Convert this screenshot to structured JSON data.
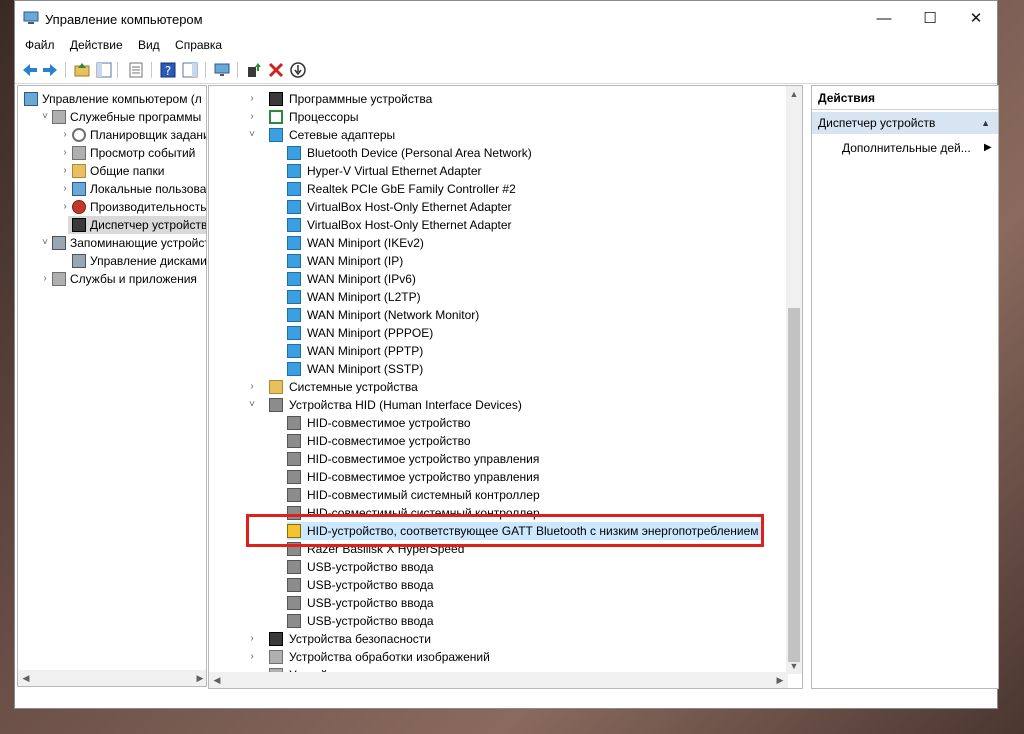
{
  "window": {
    "title": "Управление компьютером"
  },
  "menu": [
    "Файл",
    "Действие",
    "Вид",
    "Справка"
  ],
  "left_tree": {
    "root": "Управление компьютером (л",
    "items": [
      {
        "label": "Служебные программы",
        "level": 1,
        "expander": "down",
        "icon": "tools-icon"
      },
      {
        "label": "Планировщик заданий",
        "level": 2,
        "expander": "right",
        "icon": "clock-icon"
      },
      {
        "label": "Просмотр событий",
        "level": 2,
        "expander": "right",
        "icon": "event-viewer-icon"
      },
      {
        "label": "Общие папки",
        "level": 2,
        "expander": "right",
        "icon": "folder-icon"
      },
      {
        "label": "Локальные пользовате",
        "level": 2,
        "expander": "right",
        "icon": "users-icon"
      },
      {
        "label": "Производительность",
        "level": 2,
        "expander": "right",
        "icon": "performance-icon"
      },
      {
        "label": "Диспетчер устройств",
        "level": 2,
        "expander": "",
        "icon": "device-manager-icon",
        "selected": true
      },
      {
        "label": "Запоминающие устройст",
        "level": 1,
        "expander": "down",
        "icon": "storage-icon"
      },
      {
        "label": "Управление дисками",
        "level": 2,
        "expander": "",
        "icon": "disk-icon"
      },
      {
        "label": "Службы и приложения",
        "level": 1,
        "expander": "right",
        "icon": "services-icon"
      }
    ]
  },
  "device_tree": [
    {
      "label": "Программные устройства",
      "level": 0,
      "expander": "right",
      "icon": "chip-icon"
    },
    {
      "label": "Процессоры",
      "level": 0,
      "expander": "right",
      "icon": "processor-icon"
    },
    {
      "label": "Сетевые адаптеры",
      "level": 0,
      "expander": "down",
      "icon": "network-adapter-icon"
    },
    {
      "label": "Bluetooth Device (Personal Area Network)",
      "level": 1,
      "icon": "network-adapter-icon"
    },
    {
      "label": "Hyper-V Virtual Ethernet Adapter",
      "level": 1,
      "icon": "network-adapter-icon"
    },
    {
      "label": "Realtek PCIe GbE Family Controller #2",
      "level": 1,
      "icon": "network-adapter-icon"
    },
    {
      "label": "VirtualBox Host-Only Ethernet Adapter",
      "level": 1,
      "icon": "network-adapter-disabled-icon"
    },
    {
      "label": "VirtualBox Host-Only Ethernet Adapter",
      "level": 1,
      "icon": "network-adapter-icon"
    },
    {
      "label": "WAN Miniport (IKEv2)",
      "level": 1,
      "icon": "network-adapter-icon"
    },
    {
      "label": "WAN Miniport (IP)",
      "level": 1,
      "icon": "network-adapter-icon"
    },
    {
      "label": "WAN Miniport (IPv6)",
      "level": 1,
      "icon": "network-adapter-icon"
    },
    {
      "label": "WAN Miniport (L2TP)",
      "level": 1,
      "icon": "network-adapter-icon"
    },
    {
      "label": "WAN Miniport (Network Monitor)",
      "level": 1,
      "icon": "network-adapter-icon"
    },
    {
      "label": "WAN Miniport (PPPOE)",
      "level": 1,
      "icon": "network-adapter-icon"
    },
    {
      "label": "WAN Miniport (PPTP)",
      "level": 1,
      "icon": "network-adapter-icon"
    },
    {
      "label": "WAN Miniport (SSTP)",
      "level": 1,
      "icon": "network-adapter-icon"
    },
    {
      "label": "Системные устройства",
      "level": 0,
      "expander": "right",
      "icon": "folder-icon"
    },
    {
      "label": "Устройства HID (Human Interface Devices)",
      "level": 0,
      "expander": "down",
      "icon": "hid-icon"
    },
    {
      "label": "HID-совместимое устройство",
      "level": 1,
      "icon": "hid-icon"
    },
    {
      "label": "HID-совместимое устройство",
      "level": 1,
      "icon": "hid-icon"
    },
    {
      "label": "HID-совместимое устройство управления",
      "level": 1,
      "icon": "hid-icon"
    },
    {
      "label": "HID-совместимое устройство управления",
      "level": 1,
      "icon": "hid-icon"
    },
    {
      "label": "HID-совместимый системный контроллер",
      "level": 1,
      "icon": "hid-icon"
    },
    {
      "label": "HID-совместимый системный контроллер",
      "level": 1,
      "icon": "hid-icon"
    },
    {
      "label": "HID-устройство, соответствующее GATT Bluetooth с низким энергопотреблением",
      "level": 1,
      "icon": "hid-warning-icon",
      "highlighted": true
    },
    {
      "label": "Razer Basilisk X HyperSpeed",
      "level": 1,
      "icon": "hid-icon"
    },
    {
      "label": "USB-устройство ввода",
      "level": 1,
      "icon": "hid-icon"
    },
    {
      "label": "USB-устройство ввода",
      "level": 1,
      "icon": "hid-icon"
    },
    {
      "label": "USB-устройство ввода",
      "level": 1,
      "icon": "hid-icon"
    },
    {
      "label": "USB-устройство ввода",
      "level": 1,
      "icon": "hid-icon"
    },
    {
      "label": "Устройства безопасности",
      "level": 0,
      "expander": "right",
      "icon": "security-device-icon"
    },
    {
      "label": "Устройства обработки изображений",
      "level": 0,
      "expander": "right",
      "icon": "camera-icon"
    },
    {
      "label": "Устройства чтения смарт-карт",
      "level": 0,
      "expander": "right",
      "icon": "smartcard-reader-icon"
    }
  ],
  "actions": {
    "header": "Действия",
    "section": "Диспетчер устройств",
    "more": "Дополнительные дей..."
  }
}
